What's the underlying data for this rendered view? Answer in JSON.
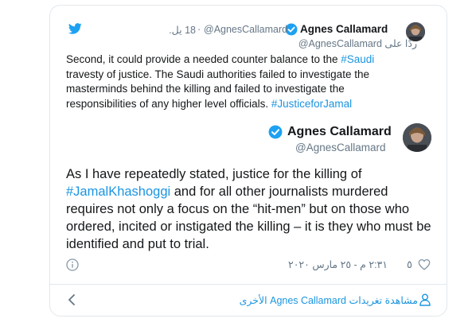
{
  "quoted_tweet": {
    "author_name": "Agnes Callamard",
    "handle": "@AgnesCallamard",
    "time": "18 يل.",
    "reply_prefix": "ردًا على",
    "reply_to": "@AgnesCallamard",
    "text_1": "Second, it could provide a needed counter balance to the ",
    "hashtag_1": "#Saudi",
    "text_2": " travesty of justice. The Saudi authorities failed to investigate the masterminds behind the killing and failed to investigate the responsibilities of any higher level officials. ",
    "hashtag_2": "#JusticeforJamal"
  },
  "main_tweet": {
    "author_name": "Agnes Callamard",
    "handle": "@AgnesCallamard",
    "text_1": "As I have repeatedly stated, justice for the killing of ",
    "hashtag": "#JamalKhashoggi",
    "text_2": " and for all other journalists murdered requires not only a focus on the “hit-men” but on those who ordered, incited or instigated the killing – it is they who must be identified and put to trial.",
    "likes": "٥",
    "timestamp": "٢:٣١ م - ٢٥ مارس ٢٠٢٠"
  },
  "footer": {
    "more_tweets": "مشاهدة تغريدات Agnes Callamard الأخرى"
  },
  "colors": {
    "link": "#1b95e0",
    "border": "#e1e8ed",
    "muted": "#657786",
    "verified": "#1da1f2"
  },
  "icons": [
    "twitter-bird-icon",
    "verified-badge-icon",
    "info-icon",
    "heart-icon",
    "person-icon",
    "chevron-left-icon"
  ]
}
